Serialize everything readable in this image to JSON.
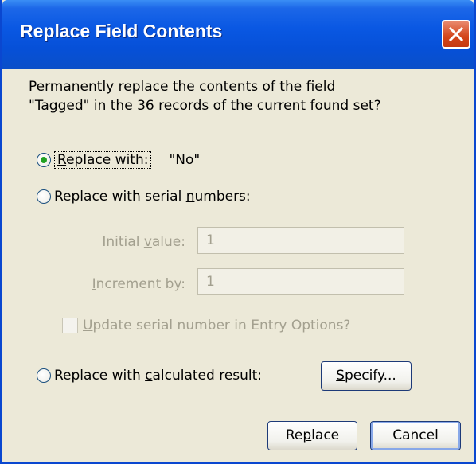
{
  "window": {
    "title": "Replace Field Contents"
  },
  "prompt": {
    "line1": "Permanently replace the contents of the field",
    "line2": "\"Tagged\" in the 36 records of the current found set?"
  },
  "options": {
    "replace_with": {
      "label": "Replace with:",
      "value": "\"No\"",
      "checked": true
    },
    "serial": {
      "label": "Replace with serial numbers:",
      "checked": false,
      "initial_value_label": "Initial value:",
      "initial_value": "1",
      "increment_label": "Increment by:",
      "increment_value": "1",
      "update_checkbox_label": "Update serial number in Entry Options?",
      "update_checked": false
    },
    "calculated": {
      "label": "Replace with calculated result:",
      "checked": false
    }
  },
  "buttons": {
    "specify": "Specify...",
    "replace": "Replace",
    "cancel": "Cancel"
  },
  "colors": {
    "titlebar": "#0a58e3",
    "dialog_bg": "#ece9d8",
    "disabled_text": "#a3a08f",
    "radio_dot": "#21a121"
  }
}
